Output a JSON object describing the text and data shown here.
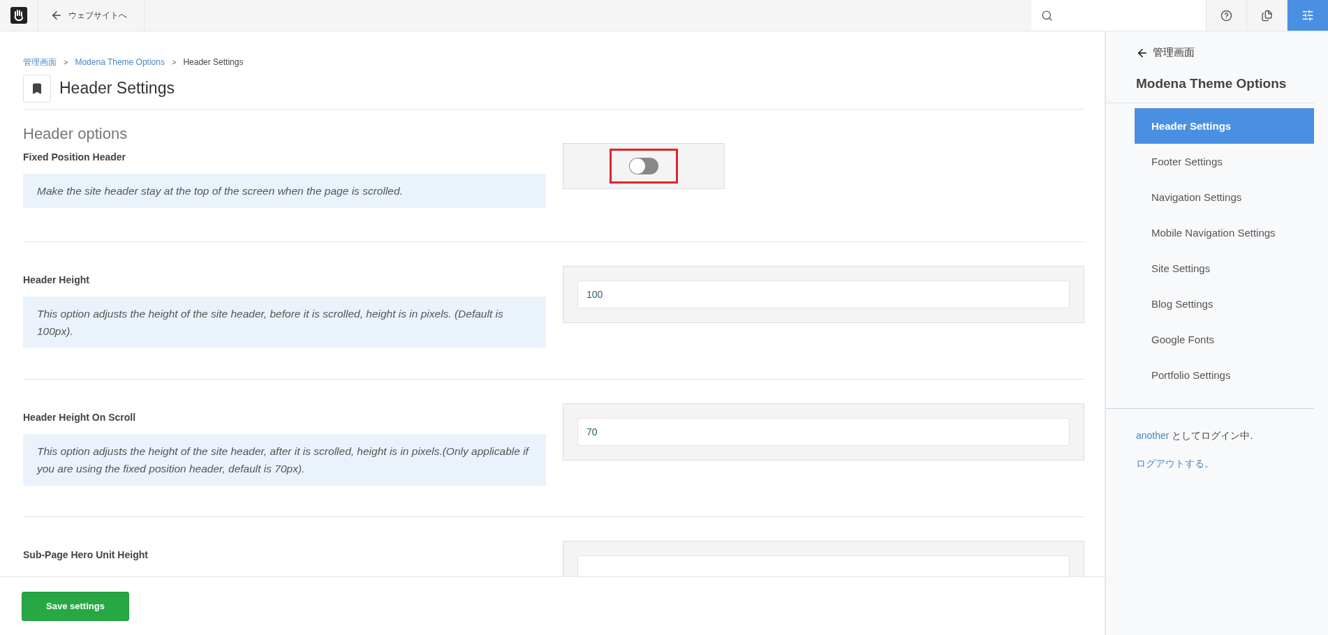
{
  "topbar": {
    "back_link": "ウェブサイトへ",
    "tools": [
      {
        "kind": "help",
        "selected": false
      },
      {
        "kind": "pages",
        "selected": false
      },
      {
        "kind": "settings",
        "selected": true
      }
    ]
  },
  "breadcrumb": [
    {
      "label": "管理画面",
      "current": false
    },
    {
      "label": "Modena Theme Options",
      "current": false,
      "separator": ">"
    },
    {
      "label": "Header Settings",
      "current": true,
      "separator": ">"
    }
  ],
  "page_title": "Header Settings",
  "section_heading": "Header options",
  "fields": [
    {
      "kind": "toggle",
      "label": "Fixed Position Header",
      "description": "Make the site header stay at the top of the screen when the page is scrolled.",
      "on": false
    },
    {
      "kind": "number",
      "label": "Header Height",
      "description": "This option adjusts the height of the site header, before it is scrolled, height is in pixels. (Default is 100px).",
      "value": "100"
    },
    {
      "kind": "number",
      "label": "Header Height On Scroll",
      "description": "This option adjusts the height of the site header, after it is scrolled, height is in pixels.(Only applicable if you are using the fixed position header, default is 70px).",
      "value": "70"
    },
    {
      "kind": "number",
      "label": "Sub-Page Hero Unit Height"
    }
  ],
  "save_button": "Save settings",
  "sidebar": {
    "back_link": "管理画面",
    "title": "Modena Theme Options",
    "items": [
      {
        "label": "Header Settings",
        "selected": true
      },
      {
        "label": "Footer Settings",
        "selected": false
      },
      {
        "label": "Navigation Settings",
        "selected": false
      },
      {
        "label": "Mobile Navigation Settings",
        "selected": false
      },
      {
        "label": "Site Settings",
        "selected": false
      },
      {
        "label": "Blog Settings",
        "selected": false
      },
      {
        "label": "Google Fonts",
        "selected": false
      },
      {
        "label": "Portfolio Settings",
        "selected": false
      }
    ],
    "user": {
      "name": "another",
      "text": "としてログイン中."
    },
    "logout": "ログアウトする。"
  }
}
